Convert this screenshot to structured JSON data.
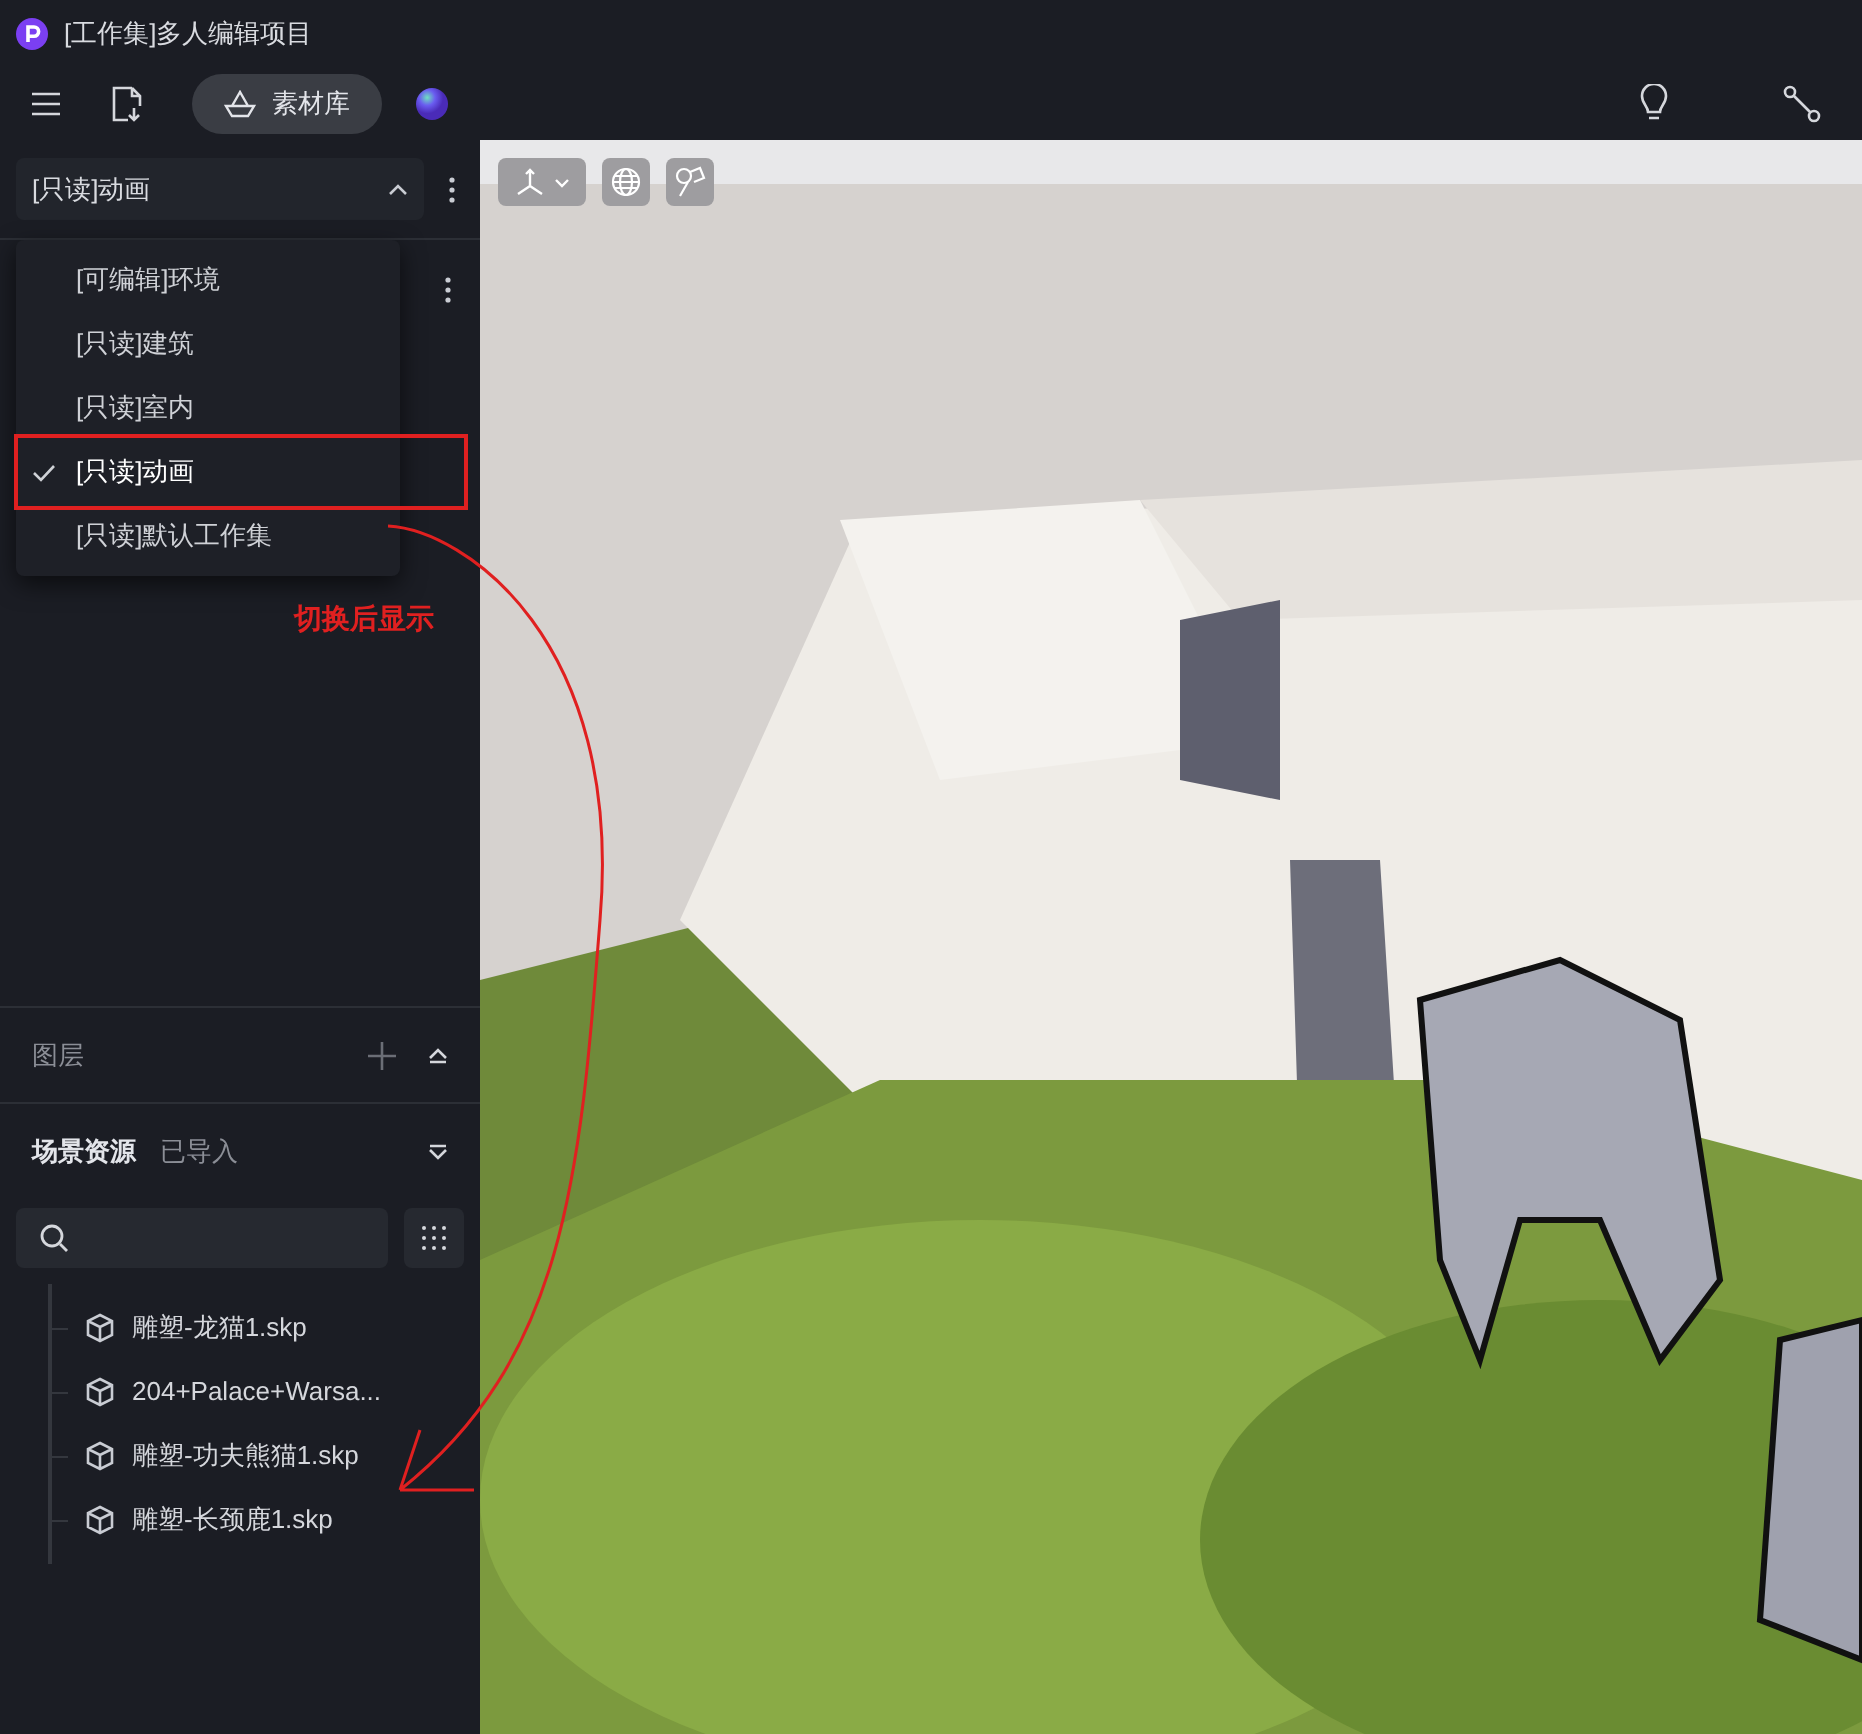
{
  "window": {
    "title": "[工作集]多人编辑项目"
  },
  "toolbar": {
    "library_button": "素材库"
  },
  "workset_select": {
    "value": "[只读]动画",
    "expanded": true
  },
  "workset_menu": [
    {
      "label": "[可编辑]环境",
      "selected": false
    },
    {
      "label": "[只读]建筑",
      "selected": false
    },
    {
      "label": "[只读]室内",
      "selected": false
    },
    {
      "label": "[只读]动画",
      "selected": true
    },
    {
      "label": "[只读]默认工作集",
      "selected": false
    }
  ],
  "layers": {
    "title": "图层"
  },
  "assets": {
    "tabs": [
      {
        "label": "场景资源",
        "selected": true
      },
      {
        "label": "已导入",
        "selected": false
      }
    ],
    "items": [
      {
        "name": "雕塑-龙猫1.skp"
      },
      {
        "name": "204+Palace+Warsa..."
      },
      {
        "name": "雕塑-功夫熊猫1.skp"
      },
      {
        "name": "雕塑-长颈鹿1.skp"
      }
    ]
  },
  "annotation": {
    "text": "切换后显示"
  }
}
